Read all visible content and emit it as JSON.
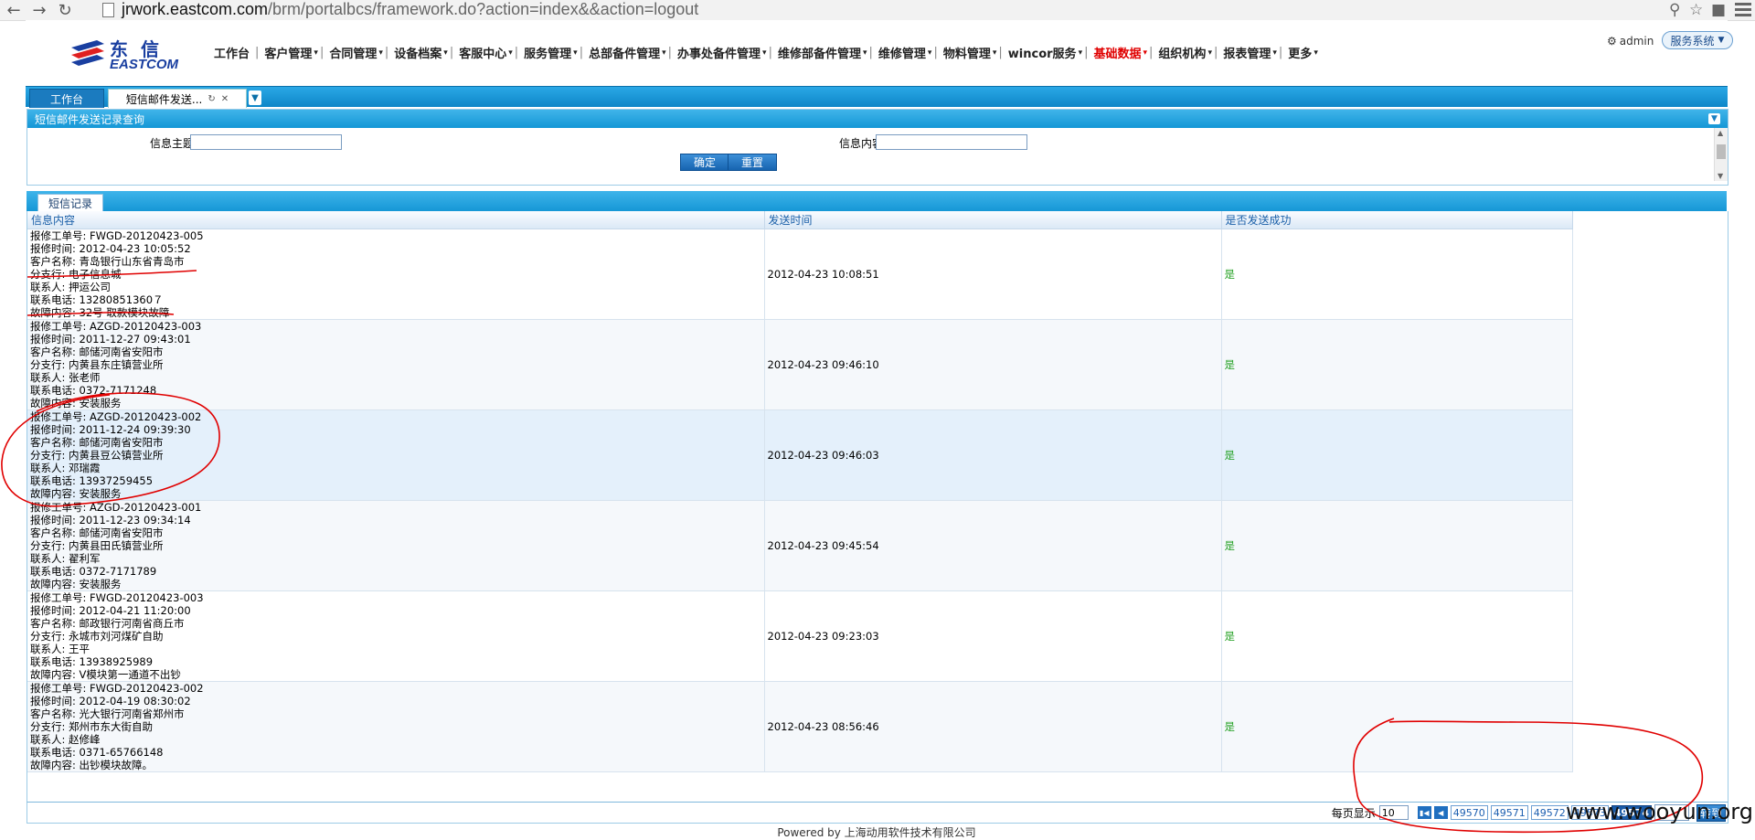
{
  "browser": {
    "url_host": "jrwork.eastcom.com",
    "url_path": "/brm/portalbcs/framework.do?action=index&&action=logout",
    "back_icon": "back-arrow-icon",
    "forward_icon": "forward-arrow-icon",
    "reload_icon": "reload-icon"
  },
  "logo": {
    "cn": "东信",
    "en": "EASTCOM"
  },
  "topnav": [
    {
      "label": "工作台",
      "dropdown": false,
      "red": false
    },
    {
      "label": "客户管理",
      "dropdown": true,
      "red": false
    },
    {
      "label": "合同管理",
      "dropdown": true,
      "red": false
    },
    {
      "label": "设备档案",
      "dropdown": true,
      "red": false
    },
    {
      "label": "客服中心",
      "dropdown": true,
      "red": false
    },
    {
      "label": "服务管理",
      "dropdown": true,
      "red": false
    },
    {
      "label": "总部备件管理",
      "dropdown": true,
      "red": false
    },
    {
      "label": "办事处备件管理",
      "dropdown": true,
      "red": false
    },
    {
      "label": "维修部备件管理",
      "dropdown": true,
      "red": false
    },
    {
      "label": "维修管理",
      "dropdown": true,
      "red": false
    },
    {
      "label": "物料管理",
      "dropdown": true,
      "red": false
    },
    {
      "label": "wincor服务",
      "dropdown": true,
      "red": false
    },
    {
      "label": "基础数据",
      "dropdown": true,
      "red": true
    },
    {
      "label": "组织机构",
      "dropdown": true,
      "red": false
    },
    {
      "label": "报表管理",
      "dropdown": true,
      "red": false
    },
    {
      "label": "更多",
      "dropdown": true,
      "red": false
    }
  ],
  "user": {
    "name": "admin",
    "system_label": "服务系统"
  },
  "tabs": {
    "home": "工作台",
    "active": "短信邮件发送..."
  },
  "query": {
    "title": "短信邮件发送记录查询",
    "subject_label": "信息主题",
    "content_label": "信息内容",
    "subject_value": "",
    "content_value": "",
    "confirm_label": "确定",
    "reset_label": "重置"
  },
  "records": {
    "tab_label": "短信记录",
    "columns": [
      "信息内容",
      "发送时间",
      "是否发送成功"
    ],
    "rows": [
      {
        "lines": [
          "报修工单号: FWGD-20120423-005",
          "报修时间: 2012-04-23 10:05:52",
          "客户名称: 青岛银行山东省青岛市",
          "分支行: 电子信息城",
          "联系人: 押运公司",
          "联系电话: 13280851360７",
          "故障内容: 32号 取款模块故障"
        ],
        "time": "2012-04-23 10:08:51",
        "ok": "是"
      },
      {
        "lines": [
          "报修工单号: AZGD-20120423-003",
          "报修时间: 2011-12-27 09:43:01",
          "客户名称: 邮储河南省安阳市",
          "分支行: 内黄县东庄镇营业所",
          "联系人: 张老师",
          "联系电话: 0372-7171248",
          "故障内容: 安装服务"
        ],
        "time": "2012-04-23 09:46:10",
        "ok": "是"
      },
      {
        "lines": [
          "报修工单号: AZGD-20120423-002",
          "报修时间: 2011-12-24 09:39:30",
          "客户名称: 邮储河南省安阳市",
          "分支行: 内黄县豆公镇营业所",
          "联系人: 邓瑞霞",
          "联系电话: 13937259455",
          "故障内容: 安装服务"
        ],
        "time": "2012-04-23 09:46:03",
        "ok": "是"
      },
      {
        "lines": [
          "报修工单号: AZGD-20120423-001",
          "报修时间: 2011-12-23 09:34:14",
          "客户名称: 邮储河南省安阳市",
          "分支行: 内黄县田氏镇营业所",
          "联系人: 翟利军",
          "联系电话: 0372-7171789",
          "故障内容: 安装服务"
        ],
        "time": "2012-04-23 09:45:54",
        "ok": "是"
      },
      {
        "lines": [
          "报修工单号: FWGD-20120423-003",
          "报修时间: 2012-04-21 11:20:00",
          "客户名称: 邮政银行河南省商丘市",
          "分支行: 永城市刘河煤矿自助",
          "联系人: 王平",
          "联系电话: 13938925989",
          "故障内容: V模块第一通道不出钞"
        ],
        "time": "2012-04-23 09:23:03",
        "ok": "是"
      },
      {
        "lines": [
          "报修工单号: FWGD-20120423-002",
          "报修时间: 2012-04-19 08:30:02",
          "客户名称: 光大银行河南省郑州市",
          "分支行: 郑州市东大街自助",
          "联系人: 赵修峰",
          "联系电话: 0371-65766148",
          "故障内容: 出钞模块故障。"
        ],
        "time": "2012-04-23 08:56:46",
        "ok": "是"
      }
    ]
  },
  "pager": {
    "per_page_label": "每页显示",
    "per_page_value": "10",
    "pages": [
      "49570",
      "49571",
      "49572",
      "49573",
      "49574"
    ],
    "current": "49574",
    "goto_label": "转到"
  },
  "footer": "Powered by 上海动用软件技术有限公司",
  "watermark": "www.wooyun.org",
  "colors": {
    "accent": "#1597d6",
    "success": "#22a022",
    "annotation": "#e00000"
  }
}
